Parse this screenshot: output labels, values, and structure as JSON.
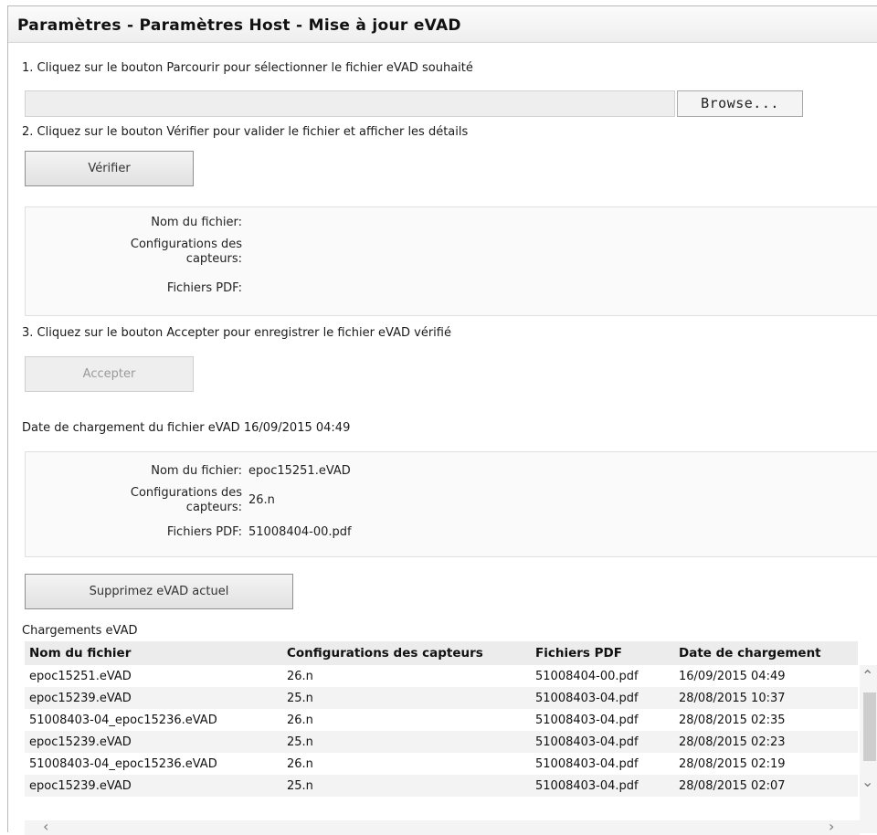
{
  "header": {
    "title": "Paramètres - Paramètres Host - Mise à jour eVAD"
  },
  "steps": {
    "step1": "1. Cliquez sur le bouton Parcourir pour sélectionner le fichier eVAD souhaité",
    "step2": "2. Cliquez sur le bouton Vérifier pour valider le fichier et afficher les détails",
    "step3": "3. Cliquez sur le bouton Accepter pour enregistrer le fichier eVAD vérifié"
  },
  "file_picker": {
    "value": "",
    "browse_label": "Browse..."
  },
  "buttons": {
    "verify": "Vérifier",
    "accept": "Accepter",
    "delete_current": "Supprimez eVAD actuel"
  },
  "verify_details": {
    "filename_label": "Nom du fichier:",
    "config_label_line1": "Configurations des",
    "config_label_line2": "capteurs:",
    "pdf_label": "Fichiers PDF:",
    "filename": "",
    "config": "",
    "pdf": ""
  },
  "current": {
    "upload_date_text": "Date de chargement du fichier eVAD 16/09/2015 04:49",
    "filename_label": "Nom du fichier:",
    "config_label_line1": "Configurations des",
    "config_label_line2": "capteurs:",
    "pdf_label": "Fichiers PDF:",
    "filename": "epoc15251.eVAD",
    "config": "26.n",
    "pdf": "51008404-00.pdf"
  },
  "uploads": {
    "title": "Chargements eVAD",
    "columns": [
      "Nom du fichier",
      "Configurations des capteurs",
      "Fichiers PDF",
      "Date de chargement"
    ],
    "rows": [
      [
        "epoc15251.eVAD",
        "26.n",
        "51008404-00.pdf",
        "16/09/2015 04:49"
      ],
      [
        "epoc15239.eVAD",
        "25.n",
        "51008403-04.pdf",
        "28/08/2015 10:37"
      ],
      [
        "51008403-04_epoc15236.eVAD",
        "26.n",
        "51008403-04.pdf",
        "28/08/2015 02:35"
      ],
      [
        "epoc15239.eVAD",
        "25.n",
        "51008403-04.pdf",
        "28/08/2015 02:23"
      ],
      [
        "51008403-04_epoc15236.eVAD",
        "26.n",
        "51008403-04.pdf",
        "28/08/2015 02:19"
      ],
      [
        "epoc15239.eVAD",
        "25.n",
        "51008403-04.pdf",
        "28/08/2015 02:07"
      ]
    ]
  },
  "icons": {
    "scroll_up": "chevron-up-icon",
    "scroll_down": "chevron-down-icon",
    "scroll_left": "chevron-left-icon",
    "scroll_right": "chevron-right-icon"
  }
}
